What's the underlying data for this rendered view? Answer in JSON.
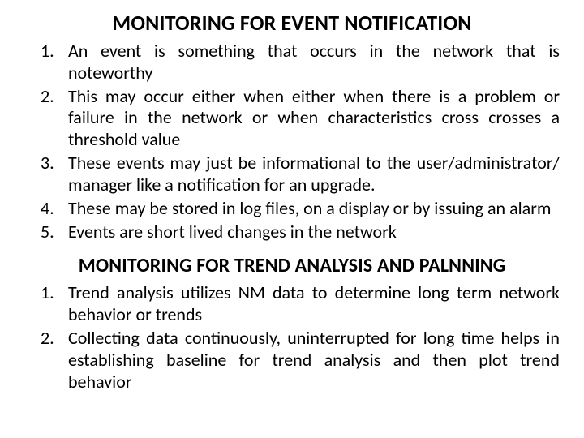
{
  "section1": {
    "title": "MONITORING FOR EVENT NOTIFICATION",
    "items": [
      "An event is something that occurs in the network that is noteworthy",
      "This may occur either when either when there is a problem or failure in the network or when characteristics cross  crosses a threshold value",
      "These events may just be informational to the user/administrator/ manager like a notification for an upgrade.",
      "These may be stored in log files, on a display or by issuing an alarm",
      "Events are short lived changes in the network"
    ]
  },
  "section2": {
    "title": "MONITORING FOR TREND ANALYSIS AND PALNNING",
    "items": [
      "Trend analysis  utilizes NM data to  determine long term network behavior or trends",
      "Collecting data continuously, uninterrupted for long time  helps in establishing baseline for trend analysis and then plot trend behavior"
    ]
  }
}
